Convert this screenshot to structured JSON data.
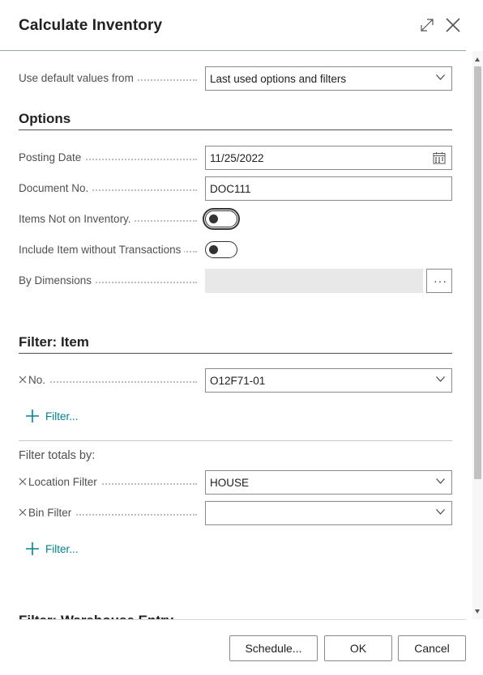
{
  "dialog": {
    "title": "Calculate Inventory",
    "expand_icon": "expand-icon",
    "close_icon": "close-icon"
  },
  "defaults": {
    "label": "Use default values from",
    "value": "Last used options and filters"
  },
  "options": {
    "title": "Options",
    "posting_date_label": "Posting Date",
    "posting_date_value": "11/25/2022",
    "document_no_label": "Document No.",
    "document_no_value": "DOC111",
    "items_not_on_inventory_label": "Items Not on Inventory.",
    "items_not_on_inventory_value": false,
    "include_item_without_transactions_label": "Include Item without Transactions",
    "include_item_without_transactions_value": false,
    "by_dimensions_label": "By Dimensions",
    "by_dimensions_value": "",
    "assist_button": "···"
  },
  "filter_item": {
    "title": "Filter: Item",
    "no_label": "No.",
    "no_value": "O12F71-01",
    "add_filter": "Filter...",
    "totals_title": "Filter totals by:",
    "location_filter_label": "Location Filter",
    "location_filter_value": "HOUSE",
    "bin_filter_label": "Bin Filter",
    "bin_filter_value": "",
    "add_filter_2": "Filter..."
  },
  "cut_section": {
    "title": "Filter: Warehouse Entry"
  },
  "footer": {
    "schedule": "Schedule...",
    "ok": "OK",
    "cancel": "Cancel"
  },
  "colors": {
    "accent": "#00838f",
    "border": "#8a8a8a",
    "disabled": "#e8e8e8"
  }
}
